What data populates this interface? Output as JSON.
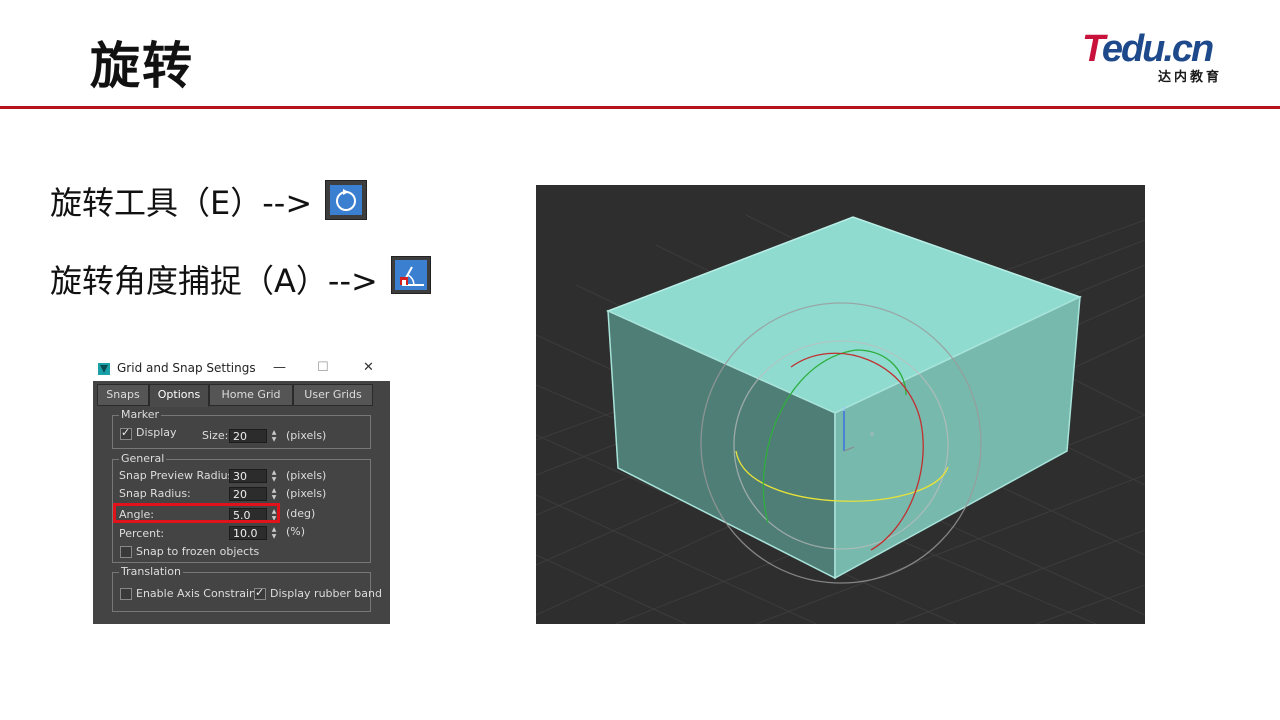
{
  "slide": {
    "title": "旋转",
    "logo": {
      "main_t": "T",
      "main_rest": "edu.cn",
      "sub": "达内教育"
    },
    "lines": [
      {
        "text": "旋转工具（E）-->"
      },
      {
        "text": "旋转角度捕捉（A）-->"
      }
    ]
  },
  "icons": {
    "rotate": "rotate-tool-icon",
    "angle_snap": "angle-snap-icon"
  },
  "dialog": {
    "title": "Grid and Snap Settings",
    "window_buttons": {
      "minimize": "—",
      "maximize": "☐",
      "close": "✕"
    },
    "tabs": [
      {
        "label": "Snaps",
        "active": false
      },
      {
        "label": "Options",
        "active": true
      },
      {
        "label": "Home Grid",
        "active": false
      },
      {
        "label": "User Grids",
        "active": false
      }
    ],
    "marker": {
      "group": "Marker",
      "display_label": "Display",
      "display_checked": true,
      "size_label": "Size:",
      "size_value": "20",
      "size_unit": "(pixels)"
    },
    "general": {
      "group": "General",
      "snap_preview_label": "Snap Preview Radius:",
      "snap_preview_value": "30",
      "snap_preview_unit": "(pixels)",
      "snap_radius_label": "Snap Radius:",
      "snap_radius_value": "20",
      "snap_radius_unit": "(pixels)",
      "angle_label": "Angle:",
      "angle_value": "5.0",
      "angle_unit": "(deg)",
      "percent_label": "Percent:",
      "percent_value": "10.0",
      "percent_unit": "(%)",
      "frozen_label": "Snap to frozen objects",
      "frozen_checked": false
    },
    "translation": {
      "group": "Translation",
      "axis_label": "Enable Axis Constraints",
      "axis_checked": false,
      "rubber_label": "Display rubber band",
      "rubber_checked": true
    }
  },
  "viewport": {
    "gizmo_labels": {
      "z": "z",
      "x": "x"
    },
    "colors": {
      "box_top": "#8fdbd0",
      "box_left": "#4f7e76",
      "box_right": "#78b9ae",
      "background": "#2e2e2e"
    }
  },
  "colors": {
    "accent_rule": "#b5121b",
    "highlight": "#e0121a"
  }
}
